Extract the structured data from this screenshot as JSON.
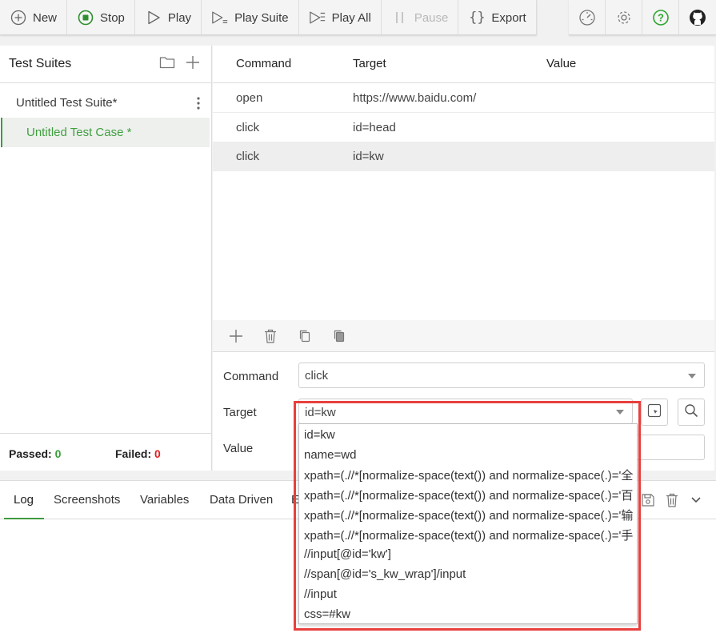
{
  "toolbar": {
    "left": [
      {
        "label": "New",
        "icon": "plus-circle-icon"
      },
      {
        "label": "Stop",
        "icon": "stop-circle-icon"
      },
      {
        "label": "Play",
        "icon": "play-icon"
      },
      {
        "label": "Play Suite",
        "icon": "play-suite-icon"
      },
      {
        "label": "Play All",
        "icon": "play-all-icon"
      },
      {
        "label": "Pause",
        "icon": "pause-icon"
      },
      {
        "label": "Export",
        "icon": "braces-icon"
      }
    ],
    "right": [
      "speed-gauge-icon",
      "gear-icon",
      "help-icon",
      "github-icon"
    ]
  },
  "suites": {
    "title": "Test Suites",
    "suite_name": "Untitled Test Suite*",
    "case_name": "Untitled Test Case *",
    "passed_label": "Passed:",
    "passed_count": "0",
    "failed_label": "Failed:",
    "failed_count": "0"
  },
  "table": {
    "headers": {
      "command": "Command",
      "target": "Target",
      "value": "Value"
    },
    "rows": [
      {
        "command": "open",
        "target": "https://www.baidu.com/",
        "value": ""
      },
      {
        "command": "click",
        "target": "id=head",
        "value": ""
      },
      {
        "command": "click",
        "target": "id=kw",
        "value": ""
      }
    ]
  },
  "form": {
    "command_label": "Command",
    "command_value": "click",
    "target_label": "Target",
    "target_value": "id=kw",
    "value_label": "Value",
    "value_value": ""
  },
  "target_options": [
    "id=kw",
    "name=wd",
    "xpath=(.//*[normalize-space(text()) and normalize-space(.)='全",
    "xpath=(.//*[normalize-space(text()) and normalize-space(.)='百",
    "xpath=(.//*[normalize-space(text()) and normalize-space(.)='输",
    "xpath=(.//*[normalize-space(text()) and normalize-space(.)='手",
    "//input[@id='kw']",
    "//span[@id='s_kw_wrap']/input",
    "//input",
    "css=#kw"
  ],
  "bottom_tabs": [
    "Log",
    "Screenshots",
    "Variables",
    "Data Driven",
    "E"
  ],
  "colors": {
    "accent": "#3f9b3f",
    "failed": "#e12121",
    "highlight": "#e8403e"
  }
}
